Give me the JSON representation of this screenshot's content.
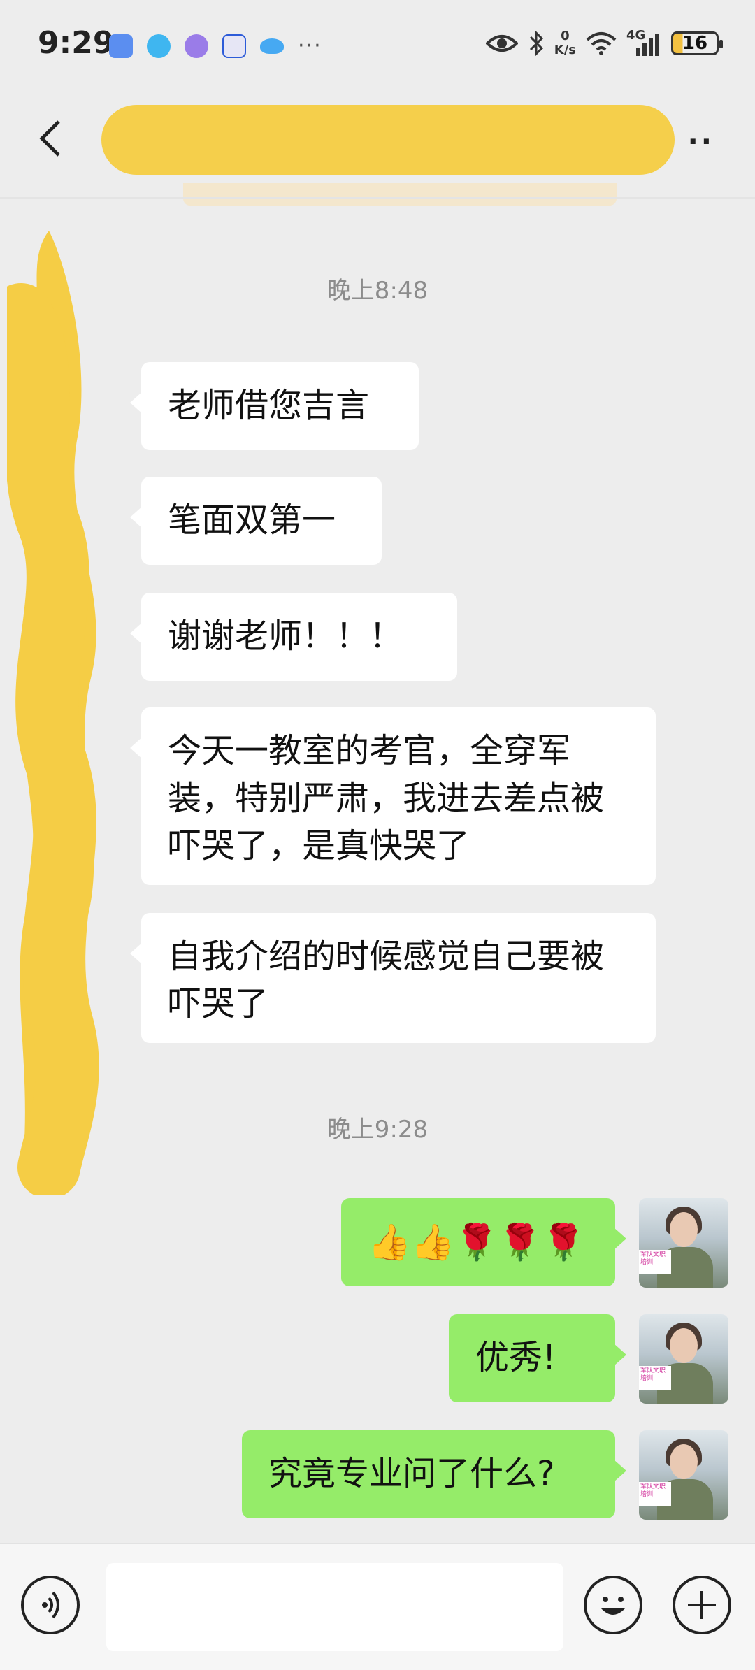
{
  "status_bar": {
    "time": "9:29",
    "net_speed_value": "0",
    "net_speed_unit": "K/s",
    "network": "4G",
    "battery": "16",
    "more": "···"
  },
  "header": {
    "back_icon": "chevron-left-icon",
    "title": "",
    "more": "··"
  },
  "messages": {
    "timestamp_1": "晚上8:48",
    "m1": "老师借您吉言",
    "m2": "笔面双第一",
    "m3": "谢谢老师！！！",
    "m4": "今天一教室的考官，全穿军装，特别严肃，我进去差点被吓哭了，是真快哭了",
    "m5": "自我介绍的时候感觉自己要被吓哭了",
    "timestamp_2": "晚上9:28",
    "r1_emoji": "👍👍🌹🌹🌹",
    "r2": "优秀!",
    "r3": "究竟专业问了什么?"
  },
  "avatar_tag": "军队文职培训",
  "input": {
    "value": "",
    "voice_icon": "voice-icon",
    "emoji_icon": "emoji-icon",
    "plus_icon": "plus-icon"
  },
  "colors": {
    "background": "#ededed",
    "bubble_self": "#95ec69",
    "bubble_other": "#ffffff",
    "redaction": "#f5cd45"
  }
}
